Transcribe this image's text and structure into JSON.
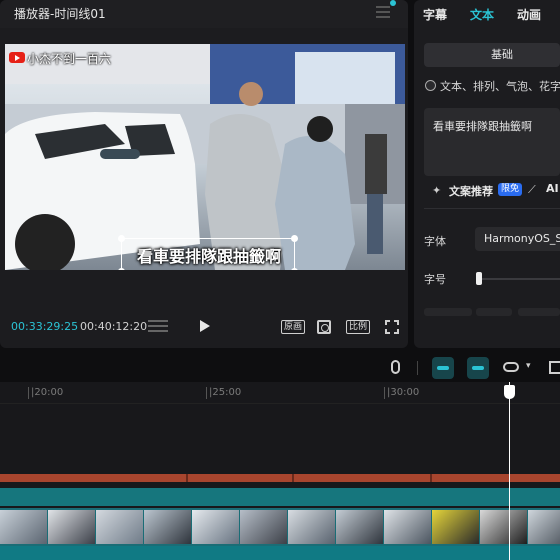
{
  "player": {
    "title": "播放器-时间线01",
    "channel_name": "小杰不到一百六",
    "subtitle": "看車要排隊跟抽籤啊",
    "current_time": "00:33:29:25",
    "total_time": "00:40:12:20",
    "btn_original": "原画",
    "btn_ratio": "比例"
  },
  "panel": {
    "tabs": [
      {
        "label": "字幕",
        "active": false
      },
      {
        "label": "文本",
        "active": true
      },
      {
        "label": "动画",
        "active": false
      }
    ],
    "basic_button": "基础",
    "option_label": "文本、排列、气泡、花字应",
    "text_value": "看車要排隊跟抽籤啊",
    "recommend_label": "文案推荐",
    "free_badge": "限免",
    "ai_label": "AI",
    "font_label": "字体",
    "font_value": "HarmonyOS_Sa",
    "size_label": "字号",
    "size_fraction": 0.0
  },
  "timeline": {
    "ticks": [
      "|20:00",
      "|25:00",
      "|30:00"
    ]
  },
  "colors": {
    "accent": "#2bc3d4",
    "audio": "#a8452e",
    "clip": "#16767d"
  }
}
